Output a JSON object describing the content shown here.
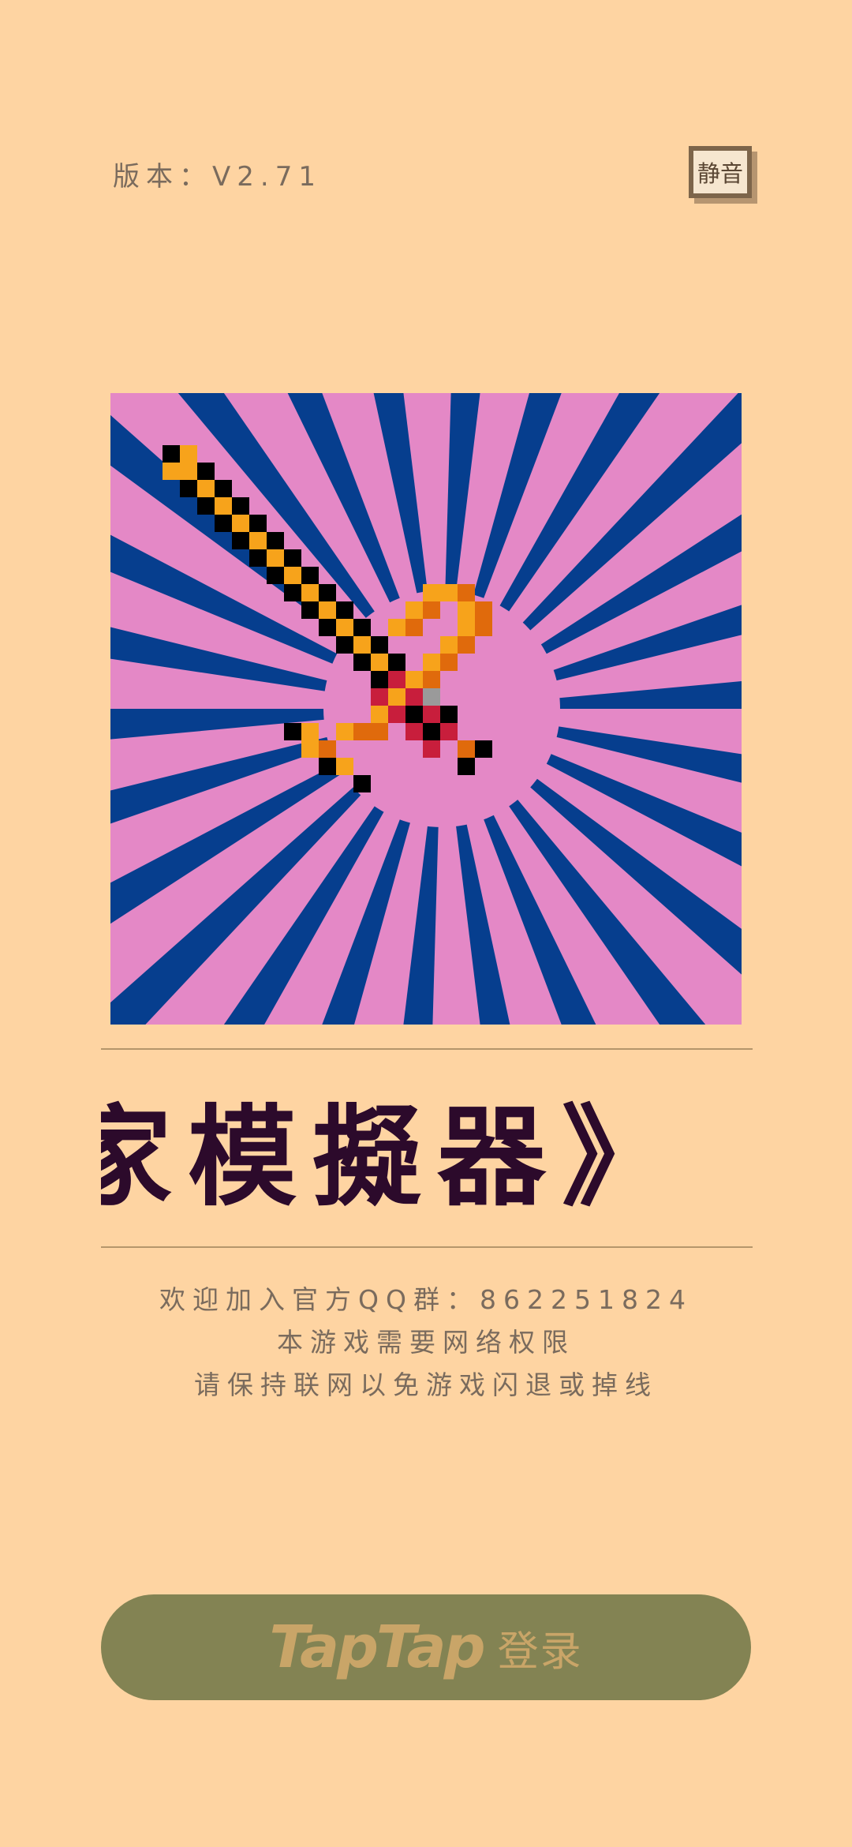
{
  "header": {
    "version_label": "版本：V2.71",
    "mute_button_label": "静音"
  },
  "hero": {
    "image_icon": "pixel-sword-icon",
    "colors": {
      "ray_blue": "#063e8e",
      "background_pink": "#e488c6"
    }
  },
  "marquee": {
    "text": "家模擬器》  《"
  },
  "info": {
    "line1": "欢迎加入官方QQ群：862251824",
    "line2": "本游戏需要网络权限",
    "line3": "请保持联网以免游戏闪退或掉线"
  },
  "login": {
    "logo_text": "TapTap",
    "label": "登录",
    "button_color": "#838353",
    "text_color": "#c9a568"
  }
}
